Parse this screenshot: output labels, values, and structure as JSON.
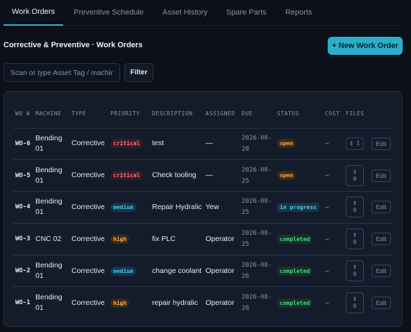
{
  "tabs": [
    "Work Orders",
    "Preventive Schedule",
    "Asset History",
    "Spare Parts",
    "Reports"
  ],
  "page": {
    "title": "Corrective & Preventive · Work Orders",
    "new_button": "+ New Work Order",
    "search_placeholder": "Scan or type Asset Tag / machine",
    "filter_button": "Filter"
  },
  "table": {
    "headers": [
      "WO #",
      "MACHINE",
      "TYPE",
      "PRIORITY",
      "DESCRIPTION",
      "ASSIGNED",
      "DUE",
      "STATUS",
      "COST",
      "FILES"
    ],
    "rows": [
      {
        "wo": "WO-6",
        "machine": "Bending 01",
        "type": "Corrective",
        "priority": "critical",
        "description": "test",
        "assigned": "—",
        "due": "2026-08-28",
        "status": "open",
        "cost": "–",
        "files_icon": "‡",
        "files": "1",
        "edit": "Edit"
      },
      {
        "wo": "WO-5",
        "machine": "Bending 01",
        "type": "Corrective",
        "priority": "critical",
        "description": "Check tooling",
        "assigned": "—",
        "due": "2026-08-25",
        "status": "open",
        "cost": "–",
        "files_icon": "‡",
        "files": "0",
        "edit": "Edit"
      },
      {
        "wo": "WO-4",
        "machine": "Bending 01",
        "type": "Corrective",
        "priority": "medium",
        "description": "Repair Hydralic",
        "assigned": "Yew",
        "due": "2026-08-25",
        "status": "in progress",
        "cost": "–",
        "files_icon": "‡",
        "files": "0",
        "edit": "Edit"
      },
      {
        "wo": "WO-3",
        "machine": "CNC 02",
        "type": "Corrective",
        "priority": "high",
        "description": "fix PLC",
        "assigned": "Operator",
        "due": "2026-08-25",
        "status": "completed",
        "cost": "–",
        "files_icon": "‡",
        "files": "0",
        "edit": "Edit"
      },
      {
        "wo": "WO-2",
        "machine": "Bending 01",
        "type": "Corrective",
        "priority": "medium",
        "description": "change coolant",
        "assigned": "Operator",
        "due": "2026-08-26",
        "status": "completed",
        "cost": "–",
        "files_icon": "‡",
        "files": "0",
        "edit": "Edit"
      },
      {
        "wo": "WO-1",
        "machine": "Bending 01",
        "type": "Corrective",
        "priority": "high",
        "description": "repair hydralic",
        "assigned": "Operator",
        "due": "2026-08-28",
        "status": "completed",
        "cost": "–",
        "files_icon": "‡",
        "files": "0",
        "edit": "Edit"
      }
    ]
  },
  "colors": {
    "accent": "#2aaecb",
    "critical": "#f3798c",
    "medium": "#4cc4ea",
    "high": "#f2b251",
    "open": "#f2ad46",
    "in_progress": "#5cc7f0",
    "completed": "#52d28c"
  }
}
